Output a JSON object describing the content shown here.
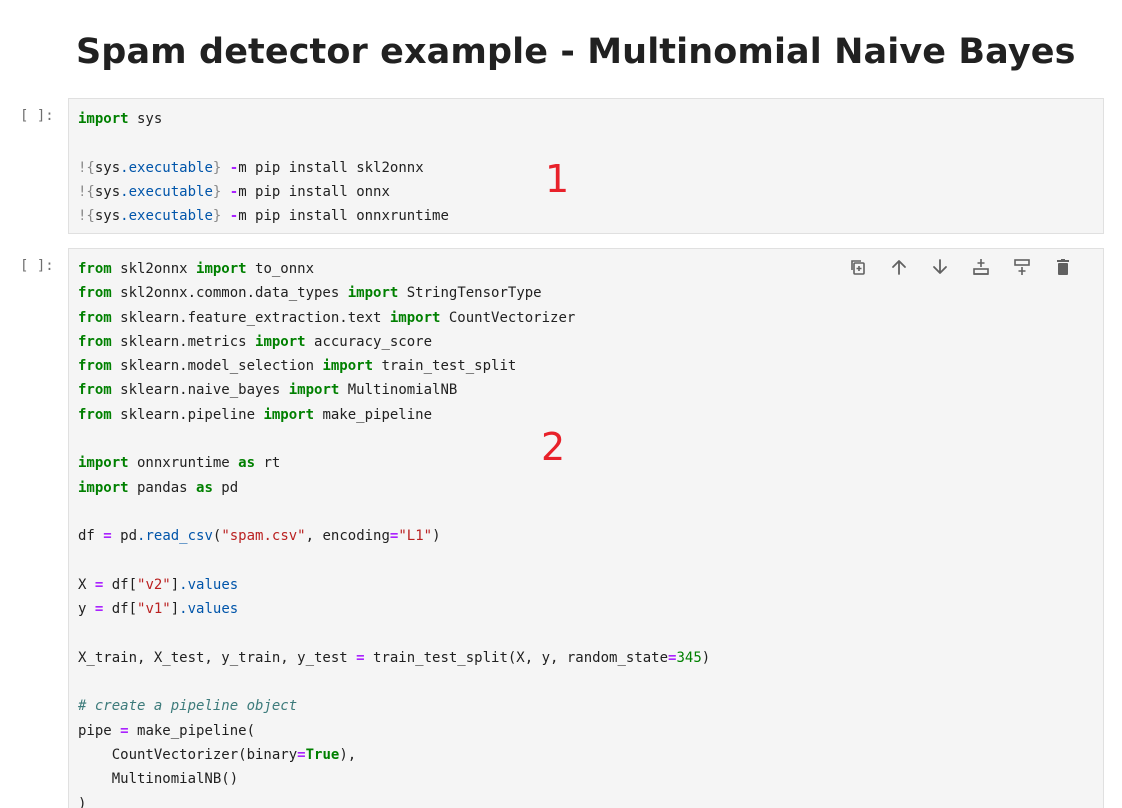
{
  "notebook": {
    "heading": "Spam detector example - Multinomial Naive Bayes",
    "annotation_color": "#e8212a",
    "cells": [
      {
        "prompt": "[ ]:",
        "annotation": "1",
        "lines": [
          [
            {
              "t": "import",
              "c": "kw"
            },
            {
              "t": " sys"
            }
          ],
          [],
          [
            {
              "t": "!{",
              "c": "brace"
            },
            {
              "t": "sys"
            },
            {
              "t": ".executable",
              "c": "attr"
            },
            {
              "t": "}",
              "c": "brace"
            },
            {
              "t": " "
            },
            {
              "t": "-",
              "c": "op"
            },
            {
              "t": "m pip install skl2onnx"
            }
          ],
          [
            {
              "t": "!{",
              "c": "brace"
            },
            {
              "t": "sys"
            },
            {
              "t": ".executable",
              "c": "attr"
            },
            {
              "t": "}",
              "c": "brace"
            },
            {
              "t": " "
            },
            {
              "t": "-",
              "c": "op"
            },
            {
              "t": "m pip install onnx"
            }
          ],
          [
            {
              "t": "!{",
              "c": "brace"
            },
            {
              "t": "sys"
            },
            {
              "t": ".executable",
              "c": "attr"
            },
            {
              "t": "}",
              "c": "brace"
            },
            {
              "t": " "
            },
            {
              "t": "-",
              "c": "op"
            },
            {
              "t": "m pip install onnxruntime"
            }
          ]
        ]
      },
      {
        "prompt": "[ ]:",
        "annotation": "2",
        "toolbar": [
          {
            "name": "duplicate-cell-icon",
            "icon": "duplicate"
          },
          {
            "name": "move-up-icon",
            "icon": "arrow-up"
          },
          {
            "name": "move-down-icon",
            "icon": "arrow-down"
          },
          {
            "name": "insert-above-icon",
            "icon": "insert-above"
          },
          {
            "name": "insert-below-icon",
            "icon": "insert-below"
          },
          {
            "name": "delete-cell-icon",
            "icon": "trash"
          }
        ],
        "lines": [
          [
            {
              "t": "from",
              "c": "kw"
            },
            {
              "t": " skl2onnx "
            },
            {
              "t": "import",
              "c": "kw"
            },
            {
              "t": " to_onnx"
            }
          ],
          [
            {
              "t": "from",
              "c": "kw"
            },
            {
              "t": " skl2onnx.common.data_types "
            },
            {
              "t": "import",
              "c": "kw"
            },
            {
              "t": " StringTensorType"
            }
          ],
          [
            {
              "t": "from",
              "c": "kw"
            },
            {
              "t": " sklearn.feature_extraction.text "
            },
            {
              "t": "import",
              "c": "kw"
            },
            {
              "t": " CountVectorizer"
            }
          ],
          [
            {
              "t": "from",
              "c": "kw"
            },
            {
              "t": " sklearn.metrics "
            },
            {
              "t": "import",
              "c": "kw"
            },
            {
              "t": " accuracy_score"
            }
          ],
          [
            {
              "t": "from",
              "c": "kw"
            },
            {
              "t": " sklearn.model_selection "
            },
            {
              "t": "import",
              "c": "kw"
            },
            {
              "t": " train_test_split"
            }
          ],
          [
            {
              "t": "from",
              "c": "kw"
            },
            {
              "t": " sklearn.naive_bayes "
            },
            {
              "t": "import",
              "c": "kw"
            },
            {
              "t": " MultinomialNB"
            }
          ],
          [
            {
              "t": "from",
              "c": "kw"
            },
            {
              "t": " sklearn.pipeline "
            },
            {
              "t": "import",
              "c": "kw"
            },
            {
              "t": " make_pipeline"
            }
          ],
          [],
          [
            {
              "t": "import",
              "c": "kw"
            },
            {
              "t": " onnxruntime "
            },
            {
              "t": "as",
              "c": "kw"
            },
            {
              "t": " rt"
            }
          ],
          [
            {
              "t": "import",
              "c": "kw"
            },
            {
              "t": " pandas "
            },
            {
              "t": "as",
              "c": "kw"
            },
            {
              "t": " pd"
            }
          ],
          [],
          [
            {
              "t": "df "
            },
            {
              "t": "=",
              "c": "op"
            },
            {
              "t": " pd"
            },
            {
              "t": ".read_csv",
              "c": "attr"
            },
            {
              "t": "("
            },
            {
              "t": "\"spam.csv\"",
              "c": "str"
            },
            {
              "t": ", encoding"
            },
            {
              "t": "=",
              "c": "op"
            },
            {
              "t": "\"L1\"",
              "c": "str"
            },
            {
              "t": ")"
            }
          ],
          [],
          [
            {
              "t": "X "
            },
            {
              "t": "=",
              "c": "op"
            },
            {
              "t": " df["
            },
            {
              "t": "\"v2\"",
              "c": "str"
            },
            {
              "t": "]"
            },
            {
              "t": ".values",
              "c": "attr"
            }
          ],
          [
            {
              "t": "y "
            },
            {
              "t": "=",
              "c": "op"
            },
            {
              "t": " df["
            },
            {
              "t": "\"v1\"",
              "c": "str"
            },
            {
              "t": "]"
            },
            {
              "t": ".values",
              "c": "attr"
            }
          ],
          [],
          [
            {
              "t": "X_train, X_test, y_train, y_test "
            },
            {
              "t": "=",
              "c": "op"
            },
            {
              "t": " train_test_split(X, y, random_state"
            },
            {
              "t": "=",
              "c": "op"
            },
            {
              "t": "345",
              "c": "num"
            },
            {
              "t": ")"
            }
          ],
          [],
          [
            {
              "t": "# create a pipeline object",
              "c": "cm"
            }
          ],
          [
            {
              "t": "pipe "
            },
            {
              "t": "=",
              "c": "op"
            },
            {
              "t": " make_pipeline("
            }
          ],
          [
            {
              "t": "    CountVectorizer(binary"
            },
            {
              "t": "=",
              "c": "op"
            },
            {
              "t": "True",
              "c": "kw"
            },
            {
              "t": "),"
            }
          ],
          [
            {
              "t": "    MultinomialNB()"
            }
          ],
          [
            {
              "t": ")"
            }
          ]
        ]
      }
    ]
  }
}
